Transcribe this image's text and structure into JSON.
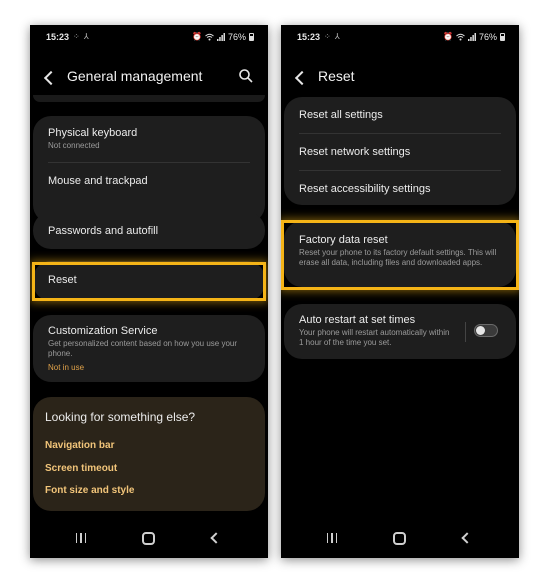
{
  "left": {
    "status": {
      "time": "15:23",
      "time_extra": "⁘ ⅄",
      "battery": "76%"
    },
    "header": {
      "title": "General management"
    },
    "items": {
      "physical_keyboard": {
        "title": "Physical keyboard",
        "subtitle": "Not connected"
      },
      "mouse_trackpad": {
        "title": "Mouse and trackpad"
      },
      "passwords": {
        "title": "Passwords and autofill"
      },
      "reset": {
        "title": "Reset"
      },
      "customization": {
        "title": "Customization Service",
        "subtitle": "Get personalized content based on how you use your phone.",
        "status": "Not in use"
      }
    },
    "suggestions": {
      "heading": "Looking for something else?",
      "links": [
        "Navigation bar",
        "Screen timeout",
        "Font size and style"
      ]
    }
  },
  "right": {
    "status": {
      "time": "15:23",
      "time_extra": "⁘ ⅄",
      "battery": "76%"
    },
    "header": {
      "title": "Reset"
    },
    "items": {
      "reset_all": {
        "title": "Reset all settings"
      },
      "reset_network": {
        "title": "Reset network settings"
      },
      "reset_accessibility": {
        "title": "Reset accessibility settings"
      },
      "factory": {
        "title": "Factory data reset",
        "subtitle": "Reset your phone to its factory default settings. This will erase all data, including files and downloaded apps."
      },
      "auto_restart": {
        "title": "Auto restart at set times",
        "subtitle": "Your phone will restart automatically within 1 hour of the time you set.",
        "toggle_on": false
      }
    }
  },
  "colors": {
    "highlight": "#f5b417",
    "accent_text": "#e0a24a",
    "link_text": "#f2c57a",
    "card_bg": "#1e1e1e"
  },
  "icons": [
    "back-arrow-icon",
    "search-icon",
    "alarm-icon",
    "wifi-icon",
    "signal-icon",
    "battery-icon",
    "recents-icon",
    "home-icon",
    "nav-back-icon"
  ]
}
